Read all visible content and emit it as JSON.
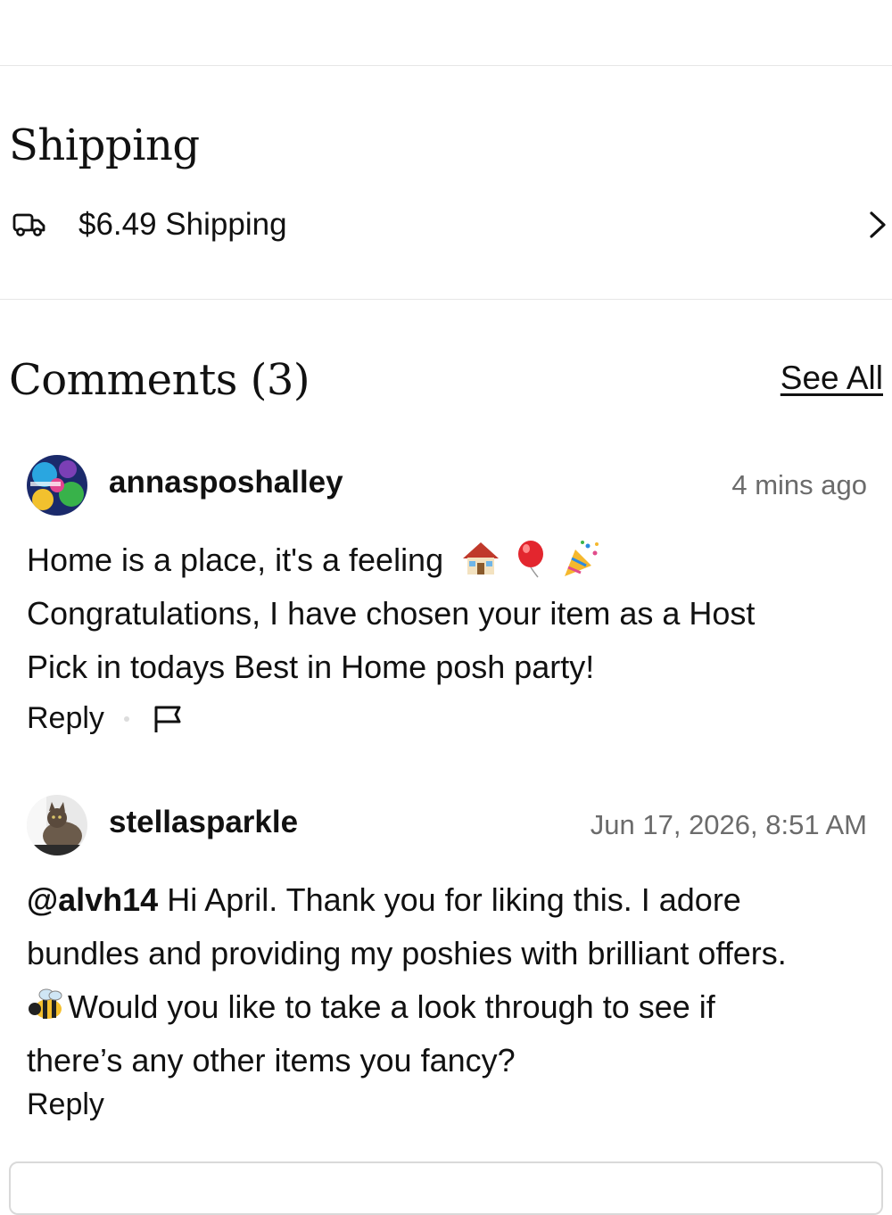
{
  "shipping": {
    "title": "Shipping",
    "price_text": "$6.49 Shipping",
    "icon": "truck-icon"
  },
  "comments": {
    "title": "Comments (3)",
    "see_all_label": "See All",
    "items": [
      {
        "username": "annasposhalley",
        "timestamp": "4 mins ago",
        "line1": "Home is a place, it's a feeling",
        "line1_emojis": [
          "house-emoji",
          "balloon-emoji",
          "party-popper-emoji"
        ],
        "line2": "Congratulations, I have chosen your item as a Host",
        "line3": "Pick in todays Best in Home posh party!",
        "reply_label": "Reply",
        "flag_icon": "flag-icon"
      },
      {
        "username": "stellasparkle",
        "timestamp": "Jun 17, 2026, 8:51 AM",
        "mention": "@alvh14",
        "line1": " Hi April. Thank you for liking this. I adore",
        "line2": "bundles and providing my poshies with brilliant offers.",
        "line3_emoji": "bee-emoji",
        "line3": "Would you like to take a look through to see if",
        "line4": "there’s any other items you fancy?",
        "reply_label": "Reply"
      }
    ]
  }
}
